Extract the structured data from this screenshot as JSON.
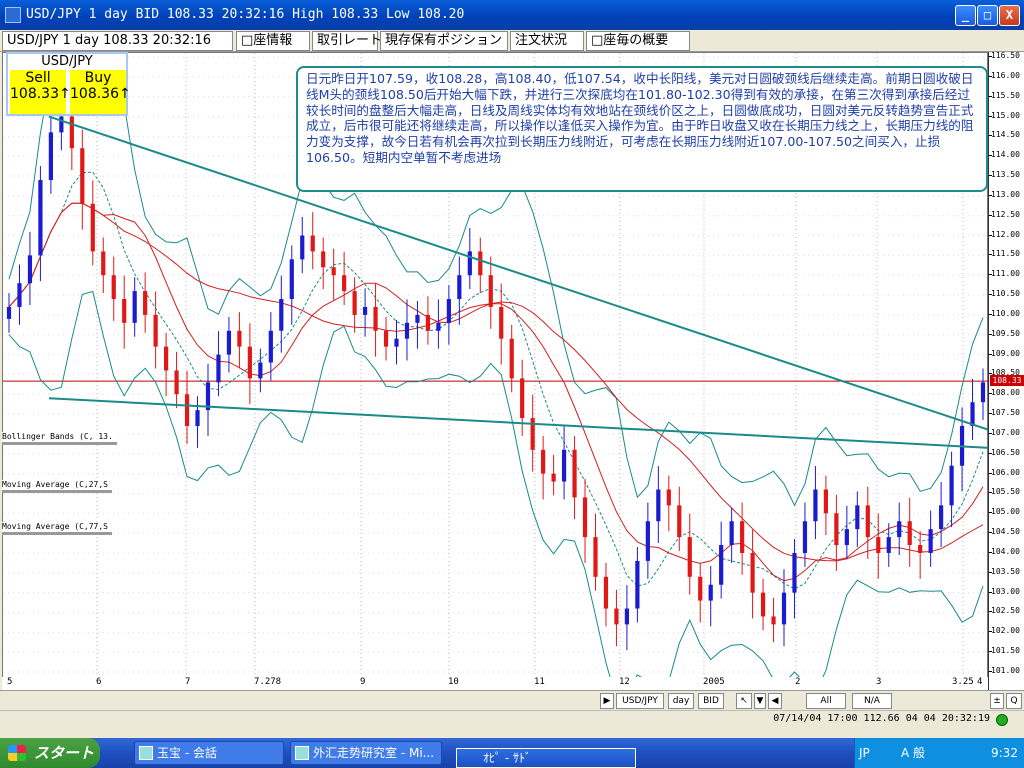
{
  "window": {
    "title": "USD/JPY 1 day BID 108.33 20:32:16 High 108.33 Low 108.20",
    "min_label": "_",
    "max_label": "□",
    "close_label": "X"
  },
  "tabs": [
    {
      "label": "USD/JPY 1 day 108.33 20:32:16"
    },
    {
      "label": "□座情報"
    },
    {
      "label": "取引レート"
    },
    {
      "label": "現存保有ポジション"
    },
    {
      "label": "注文状況"
    },
    {
      "label": "□座毎の概要"
    }
  ],
  "quote": {
    "symbol": "USD/JPY",
    "sell_label": "Sell",
    "sell_value": "108.33↑",
    "buy_label": "Buy",
    "buy_value": "108.36↑"
  },
  "annotation": "日元昨日开107.59，收108.28，高108.40，低107.54，收中长阳线，美元对日圆破颈线后继续走高。前期日圆收破日线M头的颈线108.50后开始大幅下跌，并进行三次探底均在101.80-102.30得到有效的承接，在第三次得到承接后经过较长时间的盘整后大幅走高，日线及周线实体均有效地站在颈线价区之上，日圆做底成功，日圆对美元反转趋势宣告正式成立，后市很可能还将继续走高，所以操作以逢低买入操作为宜。由于昨日收盘又收在长期压力线之上，长期压力线的阻力变为支撑，故今日若有机会再次拉到长期压力线附近，可考虑在长期压力线附近107.00-107.50之间买入，止损106.50。短期内空单暂不考虑进场",
  "indicators": [
    {
      "label": "Bollinger Bands (C, 13."
    },
    {
      "label": "Moving Average (C,27,S"
    },
    {
      "label": "Moving Average (C,77,S"
    }
  ],
  "y_axis": {
    "ticks": [
      "116.50",
      "116.00",
      "115.50",
      "115.00",
      "114.50",
      "114.00",
      "113.50",
      "113.00",
      "112.50",
      "112.00",
      "111.50",
      "111.00",
      "110.50",
      "110.00",
      "109.50",
      "109.00",
      "108.50",
      "108.00",
      "107.50",
      "107.00",
      "106.50",
      "106.00",
      "105.50",
      "105.00",
      "104.50",
      "104.00",
      "103.50",
      "103.00",
      "102.50",
      "102.00",
      "101.50",
      "101.00"
    ],
    "current_price": "108.33"
  },
  "x_axis": {
    "labels": [
      "5",
      "6",
      "7",
      "7.278",
      "9",
      "10",
      "11",
      "12",
      "2005",
      "2",
      "3",
      "3.25",
      "4"
    ]
  },
  "chart_data": {
    "type": "candlestick",
    "title": "USD/JPY 1 day",
    "ylim": [
      101.0,
      116.5
    ],
    "current_price": 108.33,
    "overlays": [
      "Bollinger Bands (C, 13.",
      "Moving Average (C,27,S",
      "Moving Average (C,77,S"
    ],
    "trendlines": [
      {
        "name": "resistance",
        "from": [
          0,
          115.0
        ],
        "to": [
          1,
          107.1
        ]
      },
      {
        "name": "neckline",
        "from": [
          0,
          107.9
        ],
        "to": [
          1,
          106.65
        ]
      }
    ],
    "closes": [
      110.2,
      110.8,
      111.5,
      113.4,
      114.6,
      115.0,
      114.2,
      112.8,
      111.6,
      111.0,
      110.4,
      109.8,
      110.6,
      110.0,
      109.2,
      108.6,
      108.0,
      107.2,
      107.6,
      108.3,
      109.0,
      109.6,
      109.2,
      108.4,
      108.8,
      109.6,
      110.4,
      111.4,
      112.0,
      111.6,
      111.2,
      111.0,
      110.6,
      110.0,
      110.2,
      109.6,
      109.2,
      109.4,
      109.8,
      110.0,
      109.6,
      109.8,
      110.4,
      111.0,
      111.6,
      111.0,
      110.2,
      109.4,
      108.4,
      107.4,
      106.6,
      106.0,
      105.8,
      106.6,
      105.4,
      104.4,
      103.4,
      102.6,
      102.2,
      102.6,
      103.8,
      104.8,
      105.6,
      105.2,
      104.4,
      103.4,
      102.8,
      103.2,
      104.2,
      104.8,
      104.0,
      103.0,
      102.4,
      102.2,
      103.0,
      104.0,
      104.8,
      105.6,
      105.0,
      104.2,
      104.6,
      105.2,
      104.4,
      104.0,
      104.4,
      104.8,
      104.2,
      104.0,
      104.6,
      105.2,
      106.2,
      107.2,
      107.8,
      108.3
    ]
  },
  "toolbar": {
    "symbol_btn": "USD/JPY",
    "period_btn": "day",
    "side_btn": "BID",
    "all_btn": "All",
    "na_btn": "N/A",
    "q_btn": "Q"
  },
  "status": {
    "text": "07/14/04 17:00  112.66 04 04 20:32:19"
  },
  "taskbar": {
    "start_label": "スタート",
    "tasks": [
      {
        "label": "玉宝 - 会話"
      },
      {
        "label": "外汇走势研究室 - Mi..."
      }
    ],
    "popup": "ｵﾋﾟ - ｻﾄﾞ",
    "tray_lang": "JP",
    "tray_ime": "A 般",
    "clock": "9:32"
  }
}
